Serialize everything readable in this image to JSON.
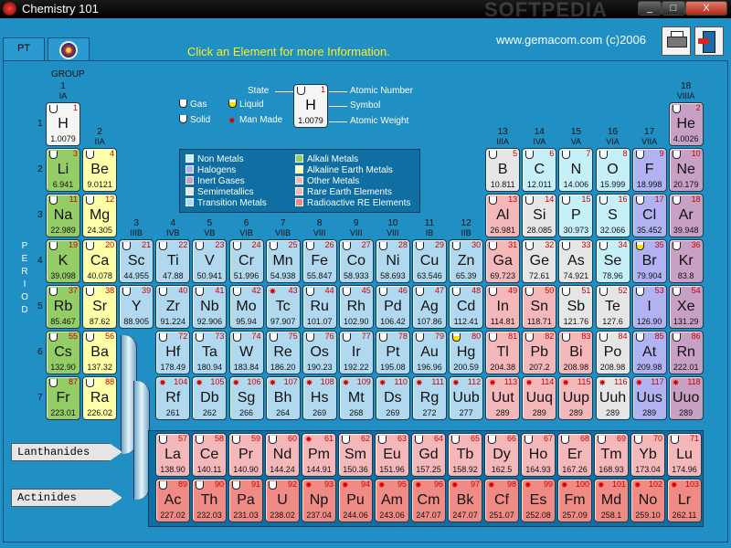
{
  "window": {
    "title": "Chemistry 101",
    "watermark": "SOFTPEDIA",
    "controls": {
      "minimize": "_",
      "maximize": "□",
      "close": "X"
    }
  },
  "toolbar": {
    "tab_pt": "PT",
    "logo_icon": "atom-icon",
    "instruction": "Click an Element for more Information.",
    "website": "www.gemacom.com  (c)2006",
    "print_icon": "printer-icon",
    "exit_icon": "exit-door-icon"
  },
  "table": {
    "group_label": "GROUP",
    "period_label": "PERIOD",
    "groups": [
      {
        "n": "1",
        "sub": "IA"
      },
      {
        "n": "2",
        "sub": "IIA"
      },
      {
        "n": "3",
        "sub": "IIIB"
      },
      {
        "n": "4",
        "sub": "IVB"
      },
      {
        "n": "5",
        "sub": "VB"
      },
      {
        "n": "6",
        "sub": "VIB"
      },
      {
        "n": "7",
        "sub": "VIIB"
      },
      {
        "n": "8",
        "sub": "VIII"
      },
      {
        "n": "9",
        "sub": "VIII"
      },
      {
        "n": "10",
        "sub": "VIII"
      },
      {
        "n": "11",
        "sub": "IB"
      },
      {
        "n": "12",
        "sub": "IIB"
      },
      {
        "n": "13",
        "sub": "IIIA"
      },
      {
        "n": "14",
        "sub": "IVA"
      },
      {
        "n": "15",
        "sub": "VA"
      },
      {
        "n": "16",
        "sub": "VIA"
      },
      {
        "n": "17",
        "sub": "VIIA"
      },
      {
        "n": "18",
        "sub": "VIIIA"
      }
    ],
    "periods": [
      "1",
      "2",
      "3",
      "4",
      "5",
      "6",
      "7"
    ],
    "state_legend": {
      "gas": "Gas",
      "liquid": "Liquid",
      "solid": "Solid",
      "man_made": "Man Made"
    },
    "key": {
      "state": "State",
      "atomic_number": "Atomic Number",
      "symbol": "Symbol",
      "atomic_weight": "Atomic Weight",
      "sample_number": "1",
      "sample_symbol": "H",
      "sample_weight": "1.0079"
    },
    "legend": {
      "non_metals": "Non Metals",
      "halogens": "Halogens",
      "inert_gases": "Inert Gases",
      "semimetallics": "Semimetallics",
      "transition_metals": "Transition Metals",
      "alkali_metals": "Alkali Metals",
      "alkaline_earth_metals": "Alkaline Earth Metals",
      "other_metals": "Other Metals",
      "rare_earth_elements": "Rare Earth Elements",
      "radioactive_re_elements": "Radioactive RE Elements"
    },
    "colors": {
      "alkali": "#94cc66",
      "alkaline": "#ffffa8",
      "transition": "#b0d8ee",
      "other": "#f4b8bb",
      "nonmetal": "#c6f0f8",
      "halogen": "#b0b2f2",
      "inert": "#c7a0c4",
      "semi": "#e6e6e6",
      "rare": "#f4b8bb",
      "radio": "#f08a84"
    },
    "series_labels": {
      "lanthanides": "Lanthanides",
      "actinides": "Actinides"
    },
    "elements": [
      {
        "n": "1",
        "s": "H",
        "w": "1.0079",
        "g": 1,
        "p": 1,
        "c": "plain",
        "st": "gas"
      },
      {
        "n": "2",
        "s": "He",
        "w": "4.0026",
        "g": 18,
        "p": 1,
        "c": "inert",
        "st": "gas"
      },
      {
        "n": "3",
        "s": "Li",
        "w": "6.941",
        "g": 1,
        "p": 2,
        "c": "alkali",
        "st": "solid"
      },
      {
        "n": "4",
        "s": "Be",
        "w": "9.0121",
        "g": 2,
        "p": 2,
        "c": "alkaline",
        "st": "solid"
      },
      {
        "n": "5",
        "s": "B",
        "w": "10.811",
        "g": 13,
        "p": 2,
        "c": "semi",
        "st": "solid"
      },
      {
        "n": "6",
        "s": "C",
        "w": "12.011",
        "g": 14,
        "p": 2,
        "c": "nonmetal",
        "st": "solid"
      },
      {
        "n": "7",
        "s": "N",
        "w": "14.006",
        "g": 15,
        "p": 2,
        "c": "nonmetal",
        "st": "gas"
      },
      {
        "n": "8",
        "s": "O",
        "w": "15.999",
        "g": 16,
        "p": 2,
        "c": "nonmetal",
        "st": "gas"
      },
      {
        "n": "9",
        "s": "F",
        "w": "18.998",
        "g": 17,
        "p": 2,
        "c": "halogen",
        "st": "gas"
      },
      {
        "n": "10",
        "s": "Ne",
        "w": "20.179",
        "g": 18,
        "p": 2,
        "c": "inert",
        "st": "gas"
      },
      {
        "n": "11",
        "s": "Na",
        "w": "22.989",
        "g": 1,
        "p": 3,
        "c": "alkali",
        "st": "solid"
      },
      {
        "n": "12",
        "s": "Mg",
        "w": "24.305",
        "g": 2,
        "p": 3,
        "c": "alkaline",
        "st": "solid"
      },
      {
        "n": "13",
        "s": "Al",
        "w": "26.981",
        "g": 13,
        "p": 3,
        "c": "other",
        "st": "solid"
      },
      {
        "n": "14",
        "s": "Si",
        "w": "28.085",
        "g": 14,
        "p": 3,
        "c": "semi",
        "st": "solid"
      },
      {
        "n": "15",
        "s": "P",
        "w": "30.973",
        "g": 15,
        "p": 3,
        "c": "nonmetal",
        "st": "solid"
      },
      {
        "n": "16",
        "s": "S",
        "w": "32.066",
        "g": 16,
        "p": 3,
        "c": "nonmetal",
        "st": "solid"
      },
      {
        "n": "17",
        "s": "Cl",
        "w": "35.452",
        "g": 17,
        "p": 3,
        "c": "halogen",
        "st": "gas"
      },
      {
        "n": "18",
        "s": "Ar",
        "w": "39.948",
        "g": 18,
        "p": 3,
        "c": "inert",
        "st": "gas"
      },
      {
        "n": "19",
        "s": "K",
        "w": "39.098",
        "g": 1,
        "p": 4,
        "c": "alkali",
        "st": "solid"
      },
      {
        "n": "20",
        "s": "Ca",
        "w": "40.078",
        "g": 2,
        "p": 4,
        "c": "alkaline",
        "st": "solid"
      },
      {
        "n": "21",
        "s": "Sc",
        "w": "44.955",
        "g": 3,
        "p": 4,
        "c": "transition",
        "st": "solid"
      },
      {
        "n": "22",
        "s": "Ti",
        "w": "47.88",
        "g": 4,
        "p": 4,
        "c": "transition",
        "st": "solid"
      },
      {
        "n": "23",
        "s": "V",
        "w": "50.941",
        "g": 5,
        "p": 4,
        "c": "transition",
        "st": "solid"
      },
      {
        "n": "24",
        "s": "Cr",
        "w": "51.996",
        "g": 6,
        "p": 4,
        "c": "transition",
        "st": "solid"
      },
      {
        "n": "25",
        "s": "Mn",
        "w": "54.938",
        "g": 7,
        "p": 4,
        "c": "transition",
        "st": "solid"
      },
      {
        "n": "26",
        "s": "Fe",
        "w": "55.847",
        "g": 8,
        "p": 4,
        "c": "transition",
        "st": "solid"
      },
      {
        "n": "27",
        "s": "Co",
        "w": "58.933",
        "g": 9,
        "p": 4,
        "c": "transition",
        "st": "solid"
      },
      {
        "n": "28",
        "s": "Ni",
        "w": "58.693",
        "g": 10,
        "p": 4,
        "c": "transition",
        "st": "solid"
      },
      {
        "n": "29",
        "s": "Cu",
        "w": "63.546",
        "g": 11,
        "p": 4,
        "c": "transition",
        "st": "solid"
      },
      {
        "n": "30",
        "s": "Zn",
        "w": "65.39",
        "g": 12,
        "p": 4,
        "c": "transition",
        "st": "solid"
      },
      {
        "n": "31",
        "s": "Ga",
        "w": "69.723",
        "g": 13,
        "p": 4,
        "c": "other",
        "st": "solid"
      },
      {
        "n": "32",
        "s": "Ge",
        "w": "72.61",
        "g": 14,
        "p": 4,
        "c": "semi",
        "st": "solid"
      },
      {
        "n": "33",
        "s": "As",
        "w": "74.921",
        "g": 15,
        "p": 4,
        "c": "semi",
        "st": "solid"
      },
      {
        "n": "34",
        "s": "Se",
        "w": "78.96",
        "g": 16,
        "p": 4,
        "c": "nonmetal",
        "st": "solid"
      },
      {
        "n": "35",
        "s": "Br",
        "w": "79.904",
        "g": 17,
        "p": 4,
        "c": "halogen",
        "st": "liquid"
      },
      {
        "n": "36",
        "s": "Kr",
        "w": "83.8",
        "g": 18,
        "p": 4,
        "c": "inert",
        "st": "gas"
      },
      {
        "n": "37",
        "s": "Rb",
        "w": "85.467",
        "g": 1,
        "p": 5,
        "c": "alkali",
        "st": "solid"
      },
      {
        "n": "38",
        "s": "Sr",
        "w": "87.62",
        "g": 2,
        "p": 5,
        "c": "alkaline",
        "st": "solid"
      },
      {
        "n": "39",
        "s": "Y",
        "w": "88.905",
        "g": 3,
        "p": 5,
        "c": "transition",
        "st": "solid"
      },
      {
        "n": "40",
        "s": "Zr",
        "w": "91.224",
        "g": 4,
        "p": 5,
        "c": "transition",
        "st": "solid"
      },
      {
        "n": "41",
        "s": "Nb",
        "w": "92.906",
        "g": 5,
        "p": 5,
        "c": "transition",
        "st": "solid"
      },
      {
        "n": "42",
        "s": "Mo",
        "w": "95.94",
        "g": 6,
        "p": 5,
        "c": "transition",
        "st": "solid"
      },
      {
        "n": "43",
        "s": "Tc",
        "w": "97.907",
        "g": 7,
        "p": 5,
        "c": "transition",
        "st": "man"
      },
      {
        "n": "44",
        "s": "Ru",
        "w": "101.07",
        "g": 8,
        "p": 5,
        "c": "transition",
        "st": "solid"
      },
      {
        "n": "45",
        "s": "Rh",
        "w": "102.90",
        "g": 9,
        "p": 5,
        "c": "transition",
        "st": "solid"
      },
      {
        "n": "46",
        "s": "Pd",
        "w": "106.42",
        "g": 10,
        "p": 5,
        "c": "transition",
        "st": "solid"
      },
      {
        "n": "47",
        "s": "Ag",
        "w": "107.86",
        "g": 11,
        "p": 5,
        "c": "transition",
        "st": "solid"
      },
      {
        "n": "48",
        "s": "Cd",
        "w": "112.41",
        "g": 12,
        "p": 5,
        "c": "transition",
        "st": "solid"
      },
      {
        "n": "49",
        "s": "In",
        "w": "114.81",
        "g": 13,
        "p": 5,
        "c": "other",
        "st": "solid"
      },
      {
        "n": "50",
        "s": "Sn",
        "w": "118.71",
        "g": 14,
        "p": 5,
        "c": "other",
        "st": "solid"
      },
      {
        "n": "51",
        "s": "Sb",
        "w": "121.76",
        "g": 15,
        "p": 5,
        "c": "semi",
        "st": "solid"
      },
      {
        "n": "52",
        "s": "Te",
        "w": "127.6",
        "g": 16,
        "p": 5,
        "c": "semi",
        "st": "solid"
      },
      {
        "n": "53",
        "s": "I",
        "w": "126.90",
        "g": 17,
        "p": 5,
        "c": "halogen",
        "st": "solid"
      },
      {
        "n": "54",
        "s": "Xe",
        "w": "131.29",
        "g": 18,
        "p": 5,
        "c": "inert",
        "st": "gas"
      },
      {
        "n": "55",
        "s": "Cs",
        "w": "132.90",
        "g": 1,
        "p": 6,
        "c": "alkali",
        "st": "solid"
      },
      {
        "n": "56",
        "s": "Ba",
        "w": "137.32",
        "g": 2,
        "p": 6,
        "c": "alkaline",
        "st": "solid"
      },
      {
        "n": "72",
        "s": "Hf",
        "w": "178.49",
        "g": 4,
        "p": 6,
        "c": "transition",
        "st": "solid"
      },
      {
        "n": "73",
        "s": "Ta",
        "w": "180.94",
        "g": 5,
        "p": 6,
        "c": "transition",
        "st": "solid"
      },
      {
        "n": "74",
        "s": "W",
        "w": "183.84",
        "g": 6,
        "p": 6,
        "c": "transition",
        "st": "solid"
      },
      {
        "n": "75",
        "s": "Re",
        "w": "186.20",
        "g": 7,
        "p": 6,
        "c": "transition",
        "st": "solid"
      },
      {
        "n": "76",
        "s": "Os",
        "w": "190.23",
        "g": 8,
        "p": 6,
        "c": "transition",
        "st": "solid"
      },
      {
        "n": "77",
        "s": "Ir",
        "w": "192.22",
        "g": 9,
        "p": 6,
        "c": "transition",
        "st": "solid"
      },
      {
        "n": "78",
        "s": "Pt",
        "w": "195.08",
        "g": 10,
        "p": 6,
        "c": "transition",
        "st": "solid"
      },
      {
        "n": "79",
        "s": "Au",
        "w": "196.96",
        "g": 11,
        "p": 6,
        "c": "transition",
        "st": "solid"
      },
      {
        "n": "80",
        "s": "Hg",
        "w": "200.59",
        "g": 12,
        "p": 6,
        "c": "transition",
        "st": "liquid"
      },
      {
        "n": "81",
        "s": "Tl",
        "w": "204.38",
        "g": 13,
        "p": 6,
        "c": "other",
        "st": "solid"
      },
      {
        "n": "82",
        "s": "Pb",
        "w": "207.2",
        "g": 14,
        "p": 6,
        "c": "other",
        "st": "solid"
      },
      {
        "n": "83",
        "s": "Bi",
        "w": "208.98",
        "g": 15,
        "p": 6,
        "c": "other",
        "st": "solid"
      },
      {
        "n": "84",
        "s": "Po",
        "w": "208.98",
        "g": 16,
        "p": 6,
        "c": "semi",
        "st": "solid"
      },
      {
        "n": "85",
        "s": "At",
        "w": "209.98",
        "g": 17,
        "p": 6,
        "c": "halogen",
        "st": "solid"
      },
      {
        "n": "86",
        "s": "Rn",
        "w": "222.01",
        "g": 18,
        "p": 6,
        "c": "inert",
        "st": "gas"
      },
      {
        "n": "87",
        "s": "Fr",
        "w": "223.01",
        "g": 1,
        "p": 7,
        "c": "alkali",
        "st": "solid"
      },
      {
        "n": "88",
        "s": "Ra",
        "w": "226.02",
        "g": 2,
        "p": 7,
        "c": "alkaline",
        "st": "solid"
      },
      {
        "n": "104",
        "s": "Rf",
        "w": "261",
        "g": 4,
        "p": 7,
        "c": "transition",
        "st": "man"
      },
      {
        "n": "105",
        "s": "Db",
        "w": "262",
        "g": 5,
        "p": 7,
        "c": "transition",
        "st": "man"
      },
      {
        "n": "106",
        "s": "Sg",
        "w": "266",
        "g": 6,
        "p": 7,
        "c": "transition",
        "st": "man"
      },
      {
        "n": "107",
        "s": "Bh",
        "w": "264",
        "g": 7,
        "p": 7,
        "c": "transition",
        "st": "man"
      },
      {
        "n": "108",
        "s": "Hs",
        "w": "269",
        "g": 8,
        "p": 7,
        "c": "transition",
        "st": "man"
      },
      {
        "n": "109",
        "s": "Mt",
        "w": "268",
        "g": 9,
        "p": 7,
        "c": "transition",
        "st": "man"
      },
      {
        "n": "110",
        "s": "Ds",
        "w": "269",
        "g": 10,
        "p": 7,
        "c": "transition",
        "st": "man"
      },
      {
        "n": "111",
        "s": "Rg",
        "w": "272",
        "g": 11,
        "p": 7,
        "c": "transition",
        "st": "man"
      },
      {
        "n": "112",
        "s": "Uub",
        "w": "277",
        "g": 12,
        "p": 7,
        "c": "transition",
        "st": "man"
      },
      {
        "n": "113",
        "s": "Uut",
        "w": "289",
        "g": 13,
        "p": 7,
        "c": "other",
        "st": "man"
      },
      {
        "n": "114",
        "s": "Uuq",
        "w": "289",
        "g": 14,
        "p": 7,
        "c": "other",
        "st": "man"
      },
      {
        "n": "115",
        "s": "Uup",
        "w": "289",
        "g": 15,
        "p": 7,
        "c": "other",
        "st": "man"
      },
      {
        "n": "116",
        "s": "Uuh",
        "w": "289",
        "g": 16,
        "p": 7,
        "c": "semi",
        "st": "man"
      },
      {
        "n": "117",
        "s": "Uus",
        "w": "289",
        "g": 17,
        "p": 7,
        "c": "halogen",
        "st": "man"
      },
      {
        "n": "118",
        "s": "Uuo",
        "w": "289",
        "g": 18,
        "p": 7,
        "c": "inert",
        "st": "man"
      }
    ],
    "lanthanides": [
      {
        "n": "57",
        "s": "La",
        "w": "138.90",
        "st": "solid"
      },
      {
        "n": "58",
        "s": "Ce",
        "w": "140.11",
        "st": "solid"
      },
      {
        "n": "59",
        "s": "Pr",
        "w": "140.90",
        "st": "solid"
      },
      {
        "n": "60",
        "s": "Nd",
        "w": "144.24",
        "st": "solid"
      },
      {
        "n": "61",
        "s": "Pm",
        "w": "144.91",
        "st": "man"
      },
      {
        "n": "62",
        "s": "Sm",
        "w": "150.36",
        "st": "solid"
      },
      {
        "n": "63",
        "s": "Eu",
        "w": "151.96",
        "st": "solid"
      },
      {
        "n": "64",
        "s": "Gd",
        "w": "157.25",
        "st": "solid"
      },
      {
        "n": "65",
        "s": "Tb",
        "w": "158.92",
        "st": "solid"
      },
      {
        "n": "66",
        "s": "Dy",
        "w": "162.5",
        "st": "solid"
      },
      {
        "n": "67",
        "s": "Ho",
        "w": "164.93",
        "st": "solid"
      },
      {
        "n": "68",
        "s": "Er",
        "w": "167.26",
        "st": "solid"
      },
      {
        "n": "69",
        "s": "Tm",
        "w": "168.93",
        "st": "solid"
      },
      {
        "n": "70",
        "s": "Yb",
        "w": "173.04",
        "st": "solid"
      },
      {
        "n": "71",
        "s": "Lu",
        "w": "174.96",
        "st": "solid"
      }
    ],
    "actinides": [
      {
        "n": "89",
        "s": "Ac",
        "w": "227.02",
        "st": "solid"
      },
      {
        "n": "90",
        "s": "Th",
        "w": "232.03",
        "st": "solid"
      },
      {
        "n": "91",
        "s": "Pa",
        "w": "231.03",
        "st": "solid"
      },
      {
        "n": "92",
        "s": "U",
        "w": "238.02",
        "st": "solid"
      },
      {
        "n": "93",
        "s": "Np",
        "w": "237.04",
        "st": "man"
      },
      {
        "n": "94",
        "s": "Pu",
        "w": "244.06",
        "st": "man"
      },
      {
        "n": "95",
        "s": "Am",
        "w": "243.06",
        "st": "man"
      },
      {
        "n": "96",
        "s": "Cm",
        "w": "247.07",
        "st": "man"
      },
      {
        "n": "97",
        "s": "Bk",
        "w": "247.07",
        "st": "man"
      },
      {
        "n": "98",
        "s": "Cf",
        "w": "251.07",
        "st": "man"
      },
      {
        "n": "99",
        "s": "Es",
        "w": "252.08",
        "st": "man"
      },
      {
        "n": "100",
        "s": "Fm",
        "w": "257.09",
        "st": "man"
      },
      {
        "n": "101",
        "s": "Md",
        "w": "258.1",
        "st": "man"
      },
      {
        "n": "102",
        "s": "No",
        "w": "259.10",
        "st": "man"
      },
      {
        "n": "103",
        "s": "Lr",
        "w": "262.11",
        "st": "man"
      }
    ]
  }
}
